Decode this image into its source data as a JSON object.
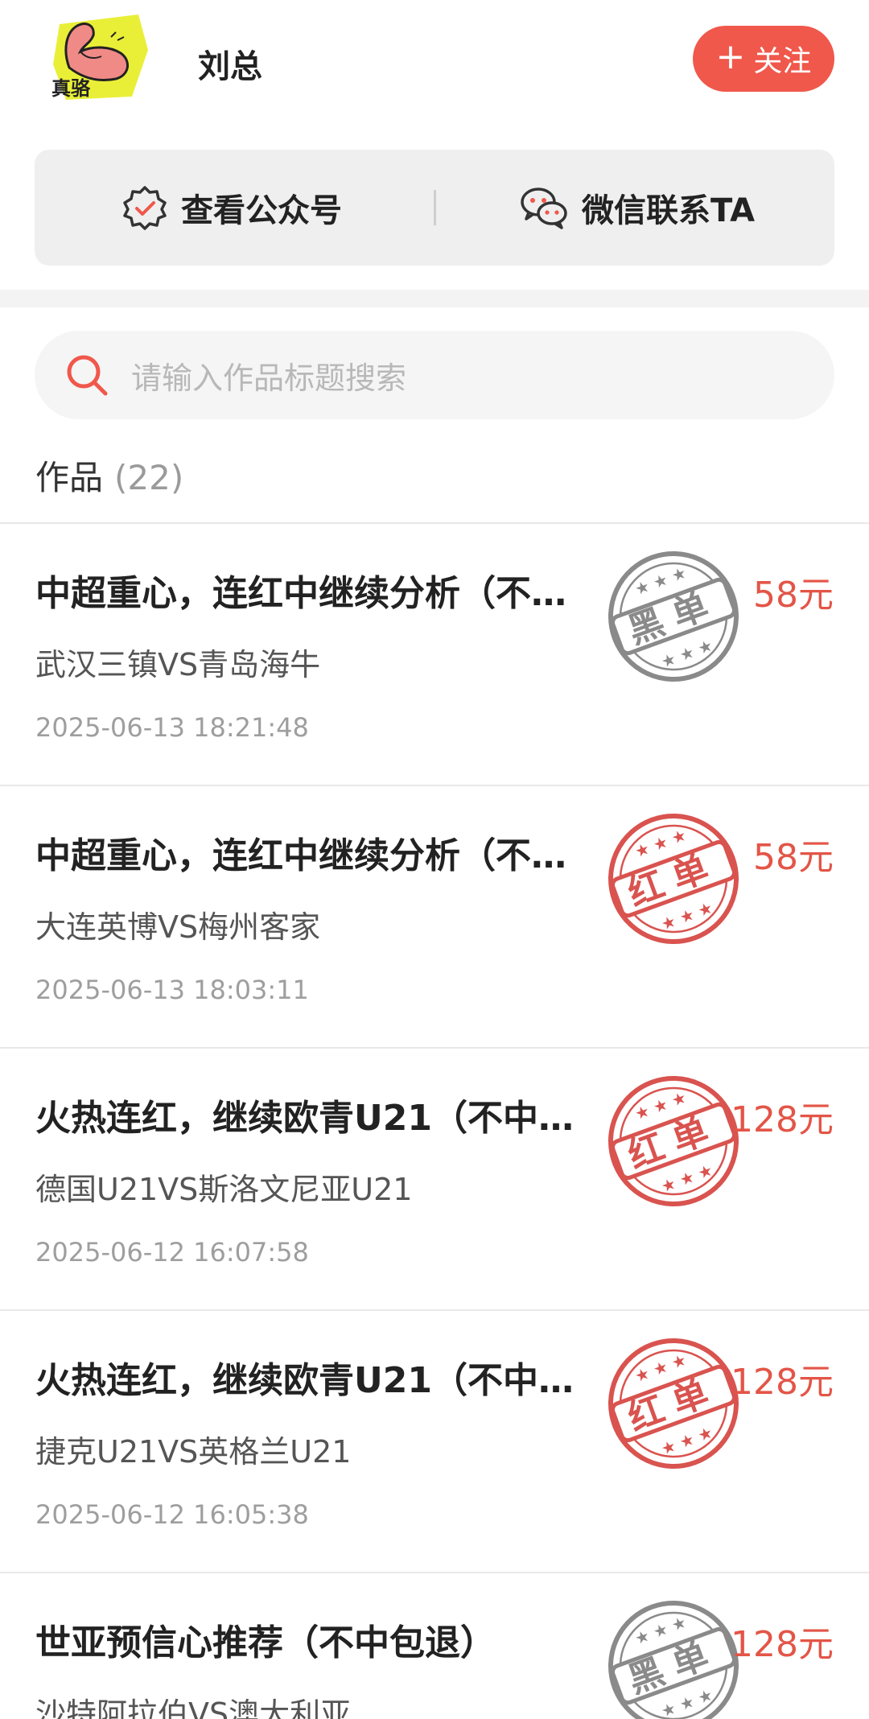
{
  "header": {
    "author_name": "刘总",
    "avatar_text": "真骆",
    "follow_label": "关注"
  },
  "actions": {
    "official_account": "查看公众号",
    "wechat_contact": "微信联系TA"
  },
  "search": {
    "placeholder": "请输入作品标题搜索"
  },
  "works": {
    "heading": "作品",
    "count": "(22)"
  },
  "colors": {
    "accent": "#f0584b",
    "price": "#e35547",
    "stamp_red": "#d9534f",
    "stamp_black": "#8a8a8a"
  },
  "stamp_labels": {
    "red": "红单",
    "black": "黑单"
  },
  "items": [
    {
      "title": "中超重心，连红中继续分析（不…",
      "subtitle": "武汉三镇VS青岛海牛",
      "time": "2025-06-13 18:21:48",
      "price": "58元",
      "stamp": "黑单"
    },
    {
      "title": "中超重心，连红中继续分析（不…",
      "subtitle": "大连英博VS梅州客家",
      "time": "2025-06-13 18:03:11",
      "price": "58元",
      "stamp": "红单"
    },
    {
      "title": "火热连红，继续欧青U21（不中…",
      "subtitle": "德国U21VS斯洛文尼亚U21",
      "time": "2025-06-12 16:07:58",
      "price": "128元",
      "stamp": "红单"
    },
    {
      "title": "火热连红，继续欧青U21（不中…",
      "subtitle": "捷克U21VS英格兰U21",
      "time": "2025-06-12 16:05:38",
      "price": "128元",
      "stamp": "红单"
    },
    {
      "title": "世亚预信心推荐（不中包退）",
      "subtitle": "沙特阿拉伯VS澳大利亚",
      "time": "",
      "price": "128元",
      "stamp": "黑单"
    }
  ]
}
